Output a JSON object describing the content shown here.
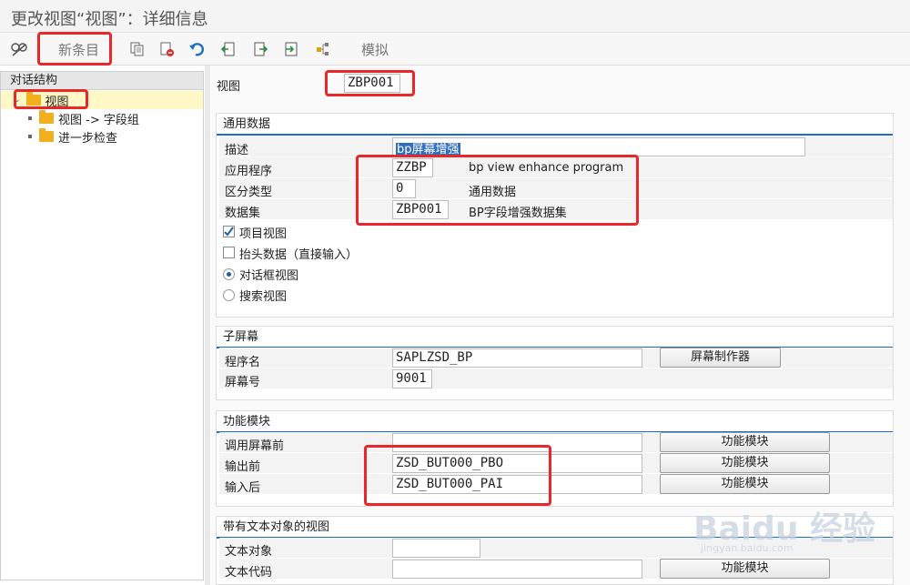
{
  "title": "更改视图“视图”：详细信息",
  "toolbar": {
    "new_entry": "新条目",
    "simulate": "模拟"
  },
  "tree": {
    "header": "对话结构",
    "root": "视图",
    "children": [
      "视图 -> 字段组",
      "进一步检查"
    ]
  },
  "view": {
    "label": "视图",
    "value": "ZBP001"
  },
  "general": {
    "title": "通用数据",
    "desc_label": "描述",
    "desc_value": "bp屏幕增强",
    "app_label": "应用程序",
    "app_value": "ZZBP",
    "app_text": "bp view enhance program",
    "diff_label": "区分类型",
    "diff_value": "0",
    "diff_text": "通用数据",
    "dataset_label": "数据集",
    "dataset_value": "ZBP001",
    "dataset_text": "BP字段增强数据集",
    "item_view": "项目视图",
    "header_data": "抬头数据（直接输入）",
    "dialog_view": "对话框视图",
    "search_view": "搜索视图"
  },
  "subscreen": {
    "title": "子屏幕",
    "program_label": "程序名",
    "program_value": "SAPLZSD_BP",
    "screen_label": "屏幕号",
    "screen_value": "9001",
    "painter_button": "屏幕制作器"
  },
  "fm": {
    "title": "功能模块",
    "call_label": "调用屏幕前",
    "call_value": "",
    "pbo_label": "输出前",
    "pbo_value": "ZSD_BUT000_PBO",
    "pai_label": "输入后",
    "pai_value": "ZSD_BUT000_PAI",
    "button": "功能模块"
  },
  "textobj": {
    "title": "带有文本对象的视图",
    "obj_label": "文本对象",
    "code_label": "文本代码",
    "button": "功能模块"
  },
  "watermark": {
    "brand": "Baidu 经验",
    "url": "jingyan.baidu.com"
  },
  "colors": {
    "highlight_box": "#e8272b",
    "group_underline": "#1f6fb6",
    "folder": "#f2b01e",
    "tree_selected": "#fff7c6"
  }
}
